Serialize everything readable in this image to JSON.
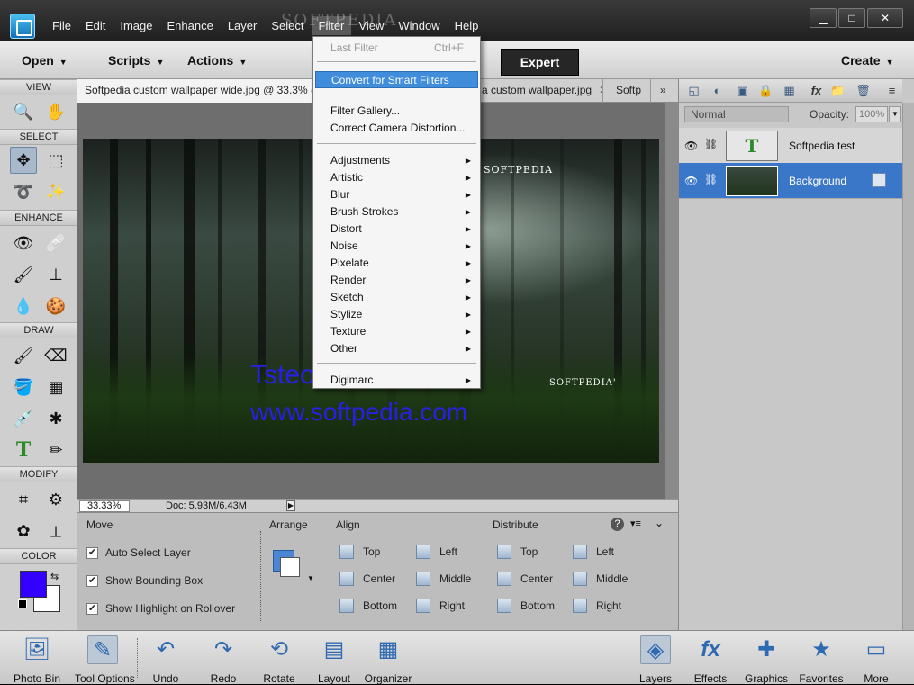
{
  "app": {
    "menus": [
      "File",
      "Edit",
      "Image",
      "Enhance",
      "Layer",
      "Select",
      "Filter",
      "View",
      "Window",
      "Help"
    ],
    "active_menu": "Filter",
    "watermark": "SOFTPEDIA",
    "window_buttons": {
      "minimize": "▁",
      "maximize": "□",
      "close": "✕"
    }
  },
  "actionbar": {
    "open": "Open",
    "scripts": "Scripts",
    "actions": "Actions",
    "expert": "Expert",
    "create": "Create"
  },
  "toolbox": {
    "sections": [
      "VIEW",
      "SELECT",
      "ENHANCE",
      "DRAW",
      "MODIFY",
      "COLOR"
    ],
    "colors": {
      "foreground": "#3300ff",
      "background": "#ffffff"
    }
  },
  "tabs": [
    {
      "label": "Softpedia custom wallpaper wide.jpg @ 33.3% (E"
    },
    {
      "label": "a custom wallpaper.jpg"
    },
    {
      "label": "Softp"
    }
  ],
  "tab_overflow": "»",
  "canvas": {
    "logo_top": "SOFTPEDIA",
    "logo_bottom": "SOFTPEDIA'",
    "text_line1": "Tsteo",
    "text_line2": "www.softpedia.com"
  },
  "status": {
    "zoom": "33.33%",
    "doc": "Doc: 5.93M/6.43M"
  },
  "tooloptions": {
    "move": "Move",
    "arrange": "Arrange",
    "align": "Align",
    "distribute": "Distribute",
    "checks": [
      {
        "label": "Auto Select Layer",
        "checked": true
      },
      {
        "label": "Show Bounding Box",
        "checked": true
      },
      {
        "label": "Show Highlight on Rollover",
        "checked": true
      }
    ],
    "align_items": [
      "Top",
      "Left",
      "Center",
      "Middle",
      "Bottom",
      "Right"
    ],
    "distribute_items": [
      "Top",
      "Left",
      "Center",
      "Middle",
      "Bottom",
      "Right"
    ]
  },
  "layers_panel": {
    "blend_mode": "Normal",
    "opacity_label": "Opacity:",
    "opacity_value": "100%",
    "layers": [
      {
        "name": "Softpedia test",
        "type": "text",
        "selected": false
      },
      {
        "name": "Background",
        "type": "image",
        "selected": true
      }
    ]
  },
  "filter_menu": {
    "items": [
      {
        "label": "Last Filter",
        "shortcut": "Ctrl+F",
        "disabled": true
      },
      {
        "label": "Convert for Smart Filters",
        "highlighted": true
      },
      {
        "label": "Filter Gallery..."
      },
      {
        "label": "Correct Camera Distortion..."
      },
      {
        "label": "Adjustments",
        "submenu": true
      },
      {
        "label": "Artistic",
        "submenu": true
      },
      {
        "label": "Blur",
        "submenu": true
      },
      {
        "label": "Brush Strokes",
        "submenu": true
      },
      {
        "label": "Distort",
        "submenu": true
      },
      {
        "label": "Noise",
        "submenu": true
      },
      {
        "label": "Pixelate",
        "submenu": true
      },
      {
        "label": "Render",
        "submenu": true
      },
      {
        "label": "Sketch",
        "submenu": true
      },
      {
        "label": "Stylize",
        "submenu": true
      },
      {
        "label": "Texture",
        "submenu": true
      },
      {
        "label": "Other",
        "submenu": true
      },
      {
        "label": "Digimarc",
        "submenu": true
      }
    ]
  },
  "bottombar": {
    "left": [
      "Photo Bin",
      "Tool Options",
      "Undo",
      "Redo",
      "Rotate",
      "Layout",
      "Organizer"
    ],
    "right": [
      "Layers",
      "Effects",
      "Graphics",
      "Favorites",
      "More"
    ]
  }
}
